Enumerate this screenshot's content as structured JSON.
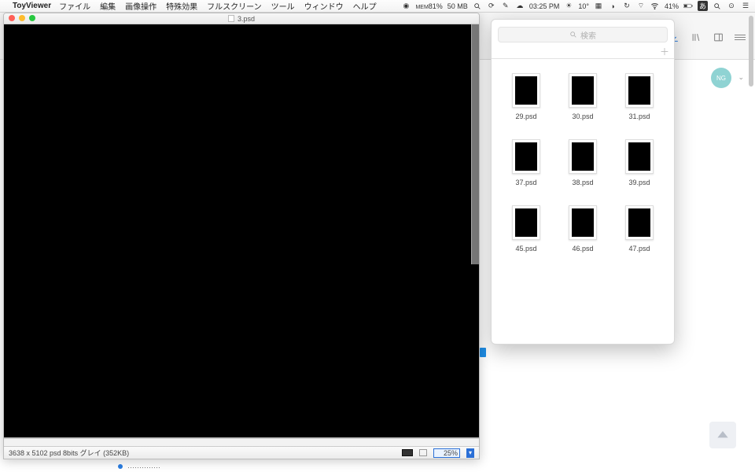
{
  "menubar": {
    "app_name": "ToyViewer",
    "items": [
      "ファイル",
      "編集",
      "画像操作",
      "特殊効果",
      "フルスクリーン",
      "ツール",
      "ウィンドウ",
      "ヘルプ"
    ],
    "status": {
      "mem_label": "MEM",
      "mem_pct": "81%",
      "mem_size": "50 MB",
      "clock": "03:25 PM",
      "temp": "10°",
      "battery_pct": "41%",
      "ime": "あ"
    }
  },
  "doc": {
    "title": "3.psd",
    "status_info": "3638 x 5102  psd  8bits グレイ  (352KB)",
    "zoom": "25%"
  },
  "finder": {
    "search_placeholder": "検索",
    "files": [
      {
        "name": "29.psd"
      },
      {
        "name": "30.psd"
      },
      {
        "name": "31.psd"
      },
      {
        "name": "37.psd"
      },
      {
        "name": "38.psd"
      },
      {
        "name": "39.psd"
      },
      {
        "name": "45.psd"
      },
      {
        "name": "46.psd"
      },
      {
        "name": "47.psd"
      }
    ]
  },
  "bg": {
    "avatar_initials": "NG",
    "peek_text": "‥‥‥‥‥‥‥"
  }
}
